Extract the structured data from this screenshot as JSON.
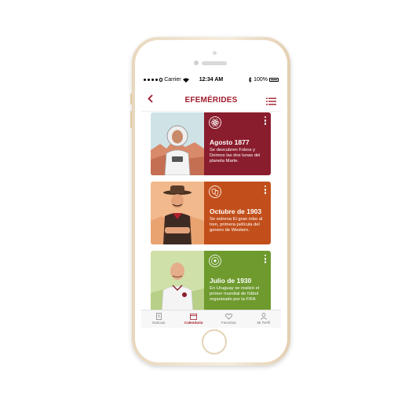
{
  "status_bar": {
    "carrier": "Carrier",
    "time": "12:34 AM",
    "battery": "100%"
  },
  "header": {
    "title": "EFEMÉRIDES",
    "back_icon": "chevron-left-icon",
    "menu_icon": "list-icon"
  },
  "cards": [
    {
      "date": "Agosto 1877",
      "description": "Se descubren Fobos y Deimos las dos lunas del planeta Marte.",
      "icon": "atom-icon",
      "color": "#8a1d2d",
      "image_bg": "#cfe3e6"
    },
    {
      "date": "Octubre de 1903",
      "description": "Se estrena El gran robo al tren, primera película del genero de Western.",
      "icon": "theater-masks-icon",
      "color": "#c24f1b",
      "image_bg": "#f2b98d"
    },
    {
      "date": "Julio de 1930",
      "description": "En Uruguay se realizó el primer mundial de fútbol organizado por la FIFA",
      "icon": "soccer-ball-icon",
      "color": "#6e9a2e",
      "image_bg": "#cfe0a8"
    }
  ],
  "tabs": [
    {
      "label": "Noticias",
      "icon": "news-icon",
      "active": false
    },
    {
      "label": "Calendario",
      "icon": "calendar-icon",
      "active": true
    },
    {
      "label": "Favoritos",
      "icon": "heart-icon",
      "active": false
    },
    {
      "label": "Mi Perfil",
      "icon": "user-icon",
      "active": false
    }
  ],
  "colors": {
    "accent": "#a01d2c"
  }
}
